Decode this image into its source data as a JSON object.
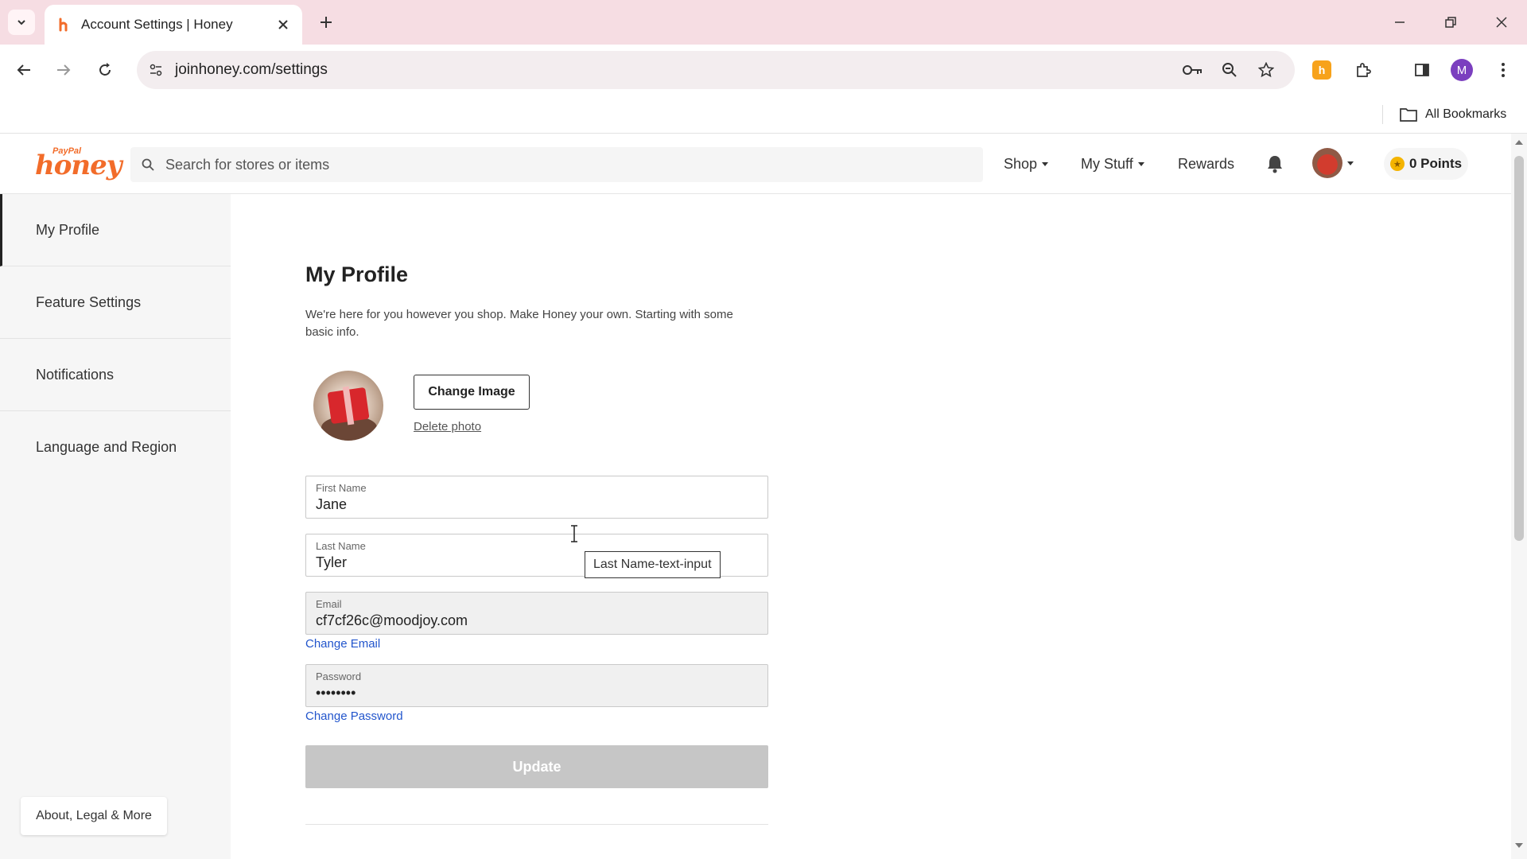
{
  "browser": {
    "tab_title": "Account Settings | Honey",
    "url": "joinhoney.com/settings",
    "profile_initial": "M",
    "bookmarks_label": "All Bookmarks",
    "extension_badge": "h"
  },
  "header": {
    "logo_top": "PayPal",
    "logo_main": "honey",
    "search_placeholder": "Search for stores or items",
    "nav": {
      "shop": "Shop",
      "my_stuff": "My Stuff",
      "rewards": "Rewards"
    },
    "points": "0 Points"
  },
  "sidebar": {
    "items": [
      {
        "label": "My Profile",
        "active": true
      },
      {
        "label": "Feature Settings",
        "active": false
      },
      {
        "label": "Notifications",
        "active": false
      },
      {
        "label": "Language and Region",
        "active": false
      }
    ],
    "about": "About, Legal & More"
  },
  "profile": {
    "title": "My Profile",
    "intro": "We're here for you however you shop. Make Honey your own. Starting with some basic info.",
    "change_image": "Change Image",
    "delete_photo": "Delete photo",
    "first_name": {
      "label": "First Name",
      "value": "Jane"
    },
    "last_name": {
      "label": "Last Name",
      "value": "Tyler"
    },
    "email": {
      "label": "Email",
      "value": "cf7cf26c@moodjoy.com"
    },
    "change_email": "Change Email",
    "password": {
      "label": "Password",
      "value": "••••••••"
    },
    "change_password": "Change Password",
    "update": "Update",
    "tooltip": "Last Name-text-input"
  },
  "colors": {
    "brand_orange": "#f26c2a",
    "link_blue": "#2255cc",
    "tab_strip": "#f6dde3",
    "disabled_button": "#c6c6c6"
  }
}
